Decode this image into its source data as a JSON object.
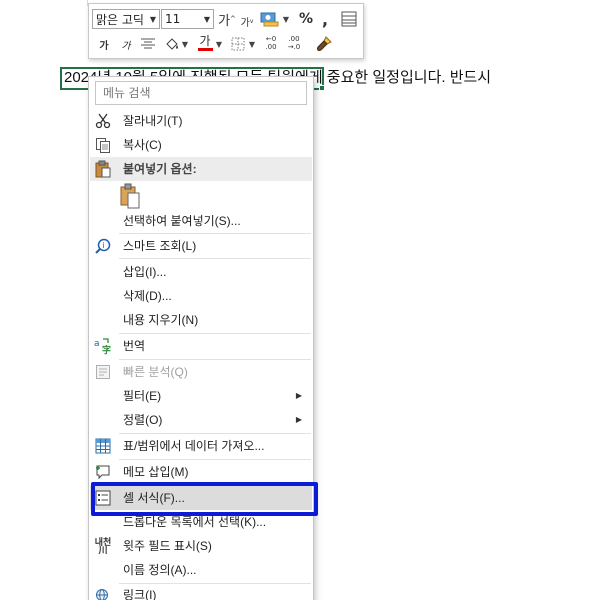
{
  "mini_toolbar": {
    "font_name": "맑은 고딕",
    "font_size": "11",
    "grow_font": "가",
    "shrink_font": "가",
    "percent": "%",
    "comma": ",",
    "bold": "가",
    "italic": "가",
    "font_color_glyph": "가",
    "dec_increase": ".00",
    "dec_decrease": ".00"
  },
  "cell": {
    "text": "2024년 10월 5일에 진행된 모든 팀원에게 중요한 일정입니다. 반드시",
    "visible_tail": "모든 팀원에게 중요한 일정입니다. 반드시"
  },
  "context_menu": {
    "search_placeholder": "메뉴 검색",
    "items": {
      "cut": "잘라내기(T)",
      "copy": "복사(C)",
      "paste_options": "붙여넣기 옵션:",
      "paste_special": "선택하여 붙여넣기(S)...",
      "smart_lookup": "스마트 조회(L)",
      "insert": "삽입(I)...",
      "delete": "삭제(D)...",
      "clear_contents": "내용 지우기(N)",
      "translate": "번역",
      "quick_analysis": "빠른 분석(Q)",
      "filter": "필터(E)",
      "sort": "정렬(O)",
      "get_data": "표/범위에서 데이터 가져오...",
      "insert_note": "메모 삽입(M)",
      "format_cells": "셀 서식(F)...",
      "pick_from_list": "드롭다운 목록에서 선택(K)...",
      "phonetic": "윗주 필드 표시(S)",
      "define_name": "이름 정의(A)...",
      "link": "링크(I)"
    }
  },
  "colors": {
    "selection_green": "#217346",
    "focus_blue": "#0b1bd6",
    "font_color_red": "#e00000"
  }
}
